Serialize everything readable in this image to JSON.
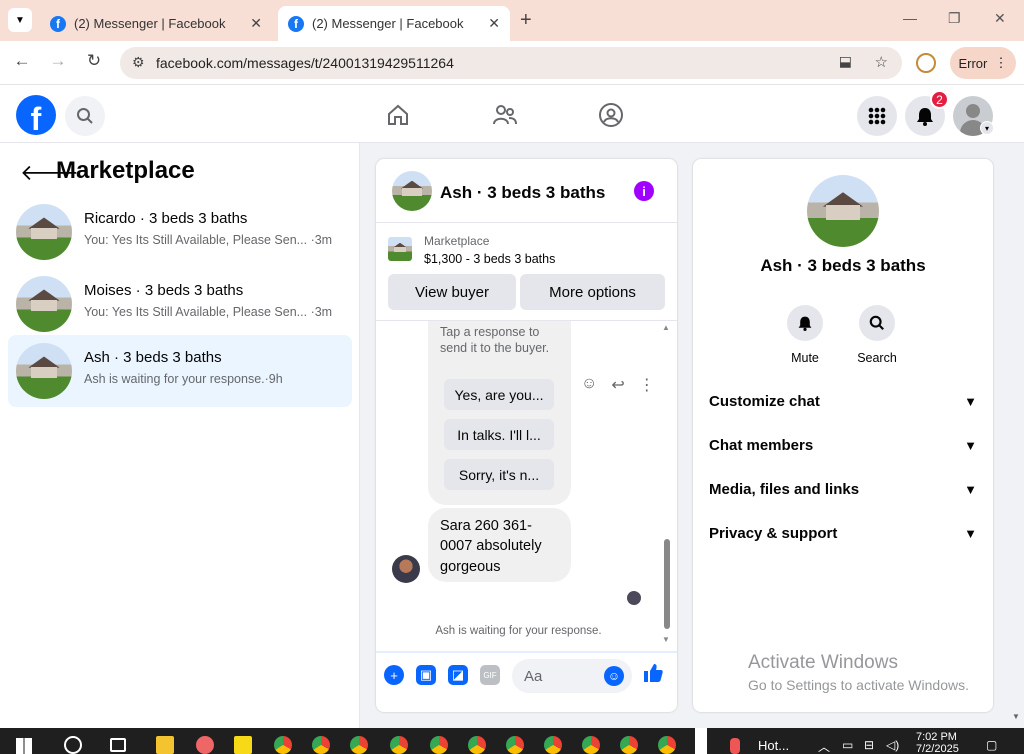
{
  "browser": {
    "tabs": [
      {
        "title": "(2) Messenger | Facebook",
        "active": false
      },
      {
        "title": "(2) Messenger | Facebook",
        "active": true
      }
    ],
    "url": "facebook.com/messages/t/24001319429511264",
    "error_label": "Error"
  },
  "fb_header": {
    "notification_count": "2",
    "icons": [
      "facebook-logo",
      "search-icon",
      "home-icon",
      "friends-icon",
      "groups-icon",
      "menu-grid-icon",
      "bell-icon",
      "avatar"
    ]
  },
  "left": {
    "title": "Marketplace",
    "conversations": [
      {
        "name": "Ricardo · 3 beds 3 baths",
        "snippet": "You: Yes Its Still Available, Please Sen...",
        "time": "·3m",
        "active": false
      },
      {
        "name": "Moises · 3 beds 3 baths",
        "snippet": "You: Yes Its Still Available, Please Sen...",
        "time": "·3m",
        "active": false
      },
      {
        "name": "Ash · 3 beds 3 baths",
        "snippet": "Ash is waiting for your response.",
        "time": "·9h",
        "active": true
      }
    ]
  },
  "chat": {
    "title": "Ash · 3 beds 3 baths",
    "marketplace_label": "Marketplace",
    "listing_price": "$1,300 - 3 beds 3 baths",
    "view_buyer": "View buyer",
    "more_options": "More options",
    "hint": "Tap a response to send it to the buyer.",
    "responses": [
      "Yes, are you...",
      "In talks. I'll l...",
      "Sorry, it's n..."
    ],
    "message": "Sara 260 361-0007 absolutely gorgeous",
    "waiting": "Ash is waiting for your response.",
    "composer_placeholder": "Aa"
  },
  "info": {
    "name": "Ash · 3 beds 3 baths",
    "actions": [
      {
        "label": "Mute",
        "icon": "bell-icon"
      },
      {
        "label": "Search",
        "icon": "search-icon"
      }
    ],
    "sections": [
      "Customize chat",
      "Chat members",
      "Media, files and links",
      "Privacy & support"
    ]
  },
  "watermark": {
    "line1": "Activate Windows",
    "line2": "Go to Settings to activate Windows."
  },
  "taskbar": {
    "weather": "Hot...",
    "time": "7:02 PM",
    "date": "7/2/2025"
  },
  "colors": {
    "fb_blue": "#0866ff",
    "tab_strip": "#f7dfd6",
    "active_conv": "#ebf5ff",
    "info_purple": "#a000ff",
    "badge_red": "#e41e3f"
  }
}
